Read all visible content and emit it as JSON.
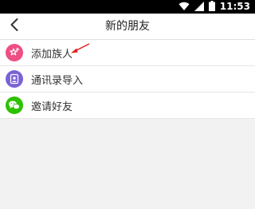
{
  "status_bar": {
    "time": "11:53",
    "icons": [
      "wifi-icon",
      "cellular-signal-icon",
      "battery-icon"
    ]
  },
  "nav": {
    "back_icon": "back-arrow-icon",
    "title": "新的朋友"
  },
  "list": {
    "items": [
      {
        "label": "添加族人",
        "icon": "add-person-star-icon",
        "icon_color": "#ee4e86"
      },
      {
        "label": "通讯录导入",
        "icon": "contacts-icon",
        "icon_color": "#7b63d6"
      },
      {
        "label": "邀请好友",
        "icon": "wechat-icon",
        "icon_color": "#2dc100"
      }
    ]
  },
  "annotation": {
    "arrow_color": "#e02020"
  }
}
